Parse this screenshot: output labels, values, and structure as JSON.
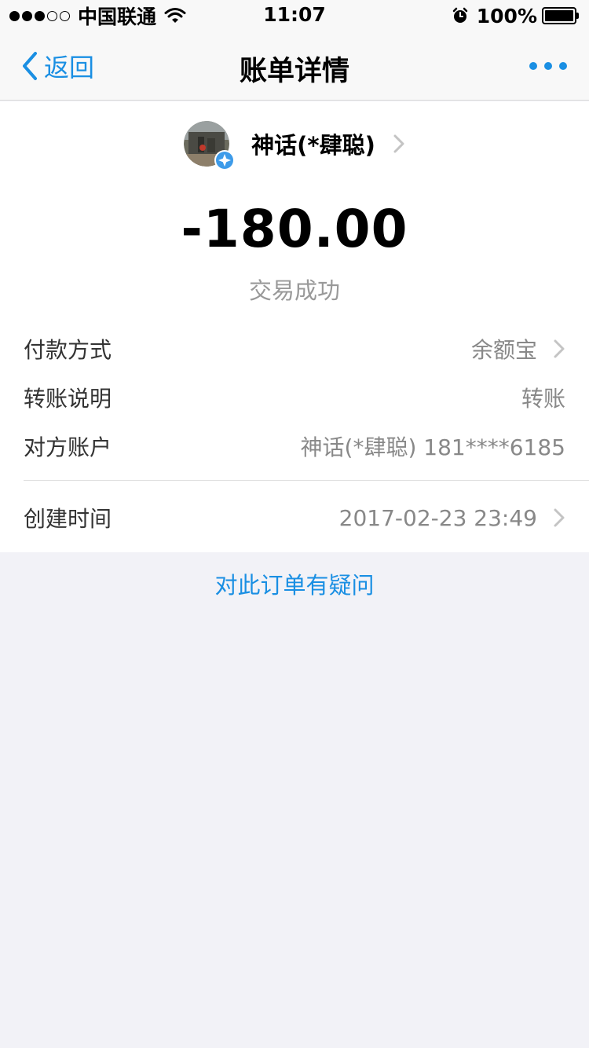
{
  "status_bar": {
    "carrier": "中国联通",
    "time": "11:07",
    "battery_percent": "100%",
    "signal_bars_filled": 3,
    "signal_bars_total": 5
  },
  "nav": {
    "back_label": "返回",
    "title": "账单详情",
    "more_icon": "more-icon"
  },
  "payee": {
    "name": "神话(*肆聪)"
  },
  "transaction": {
    "amount": "-180.00",
    "status": "交易成功"
  },
  "details": {
    "payment_method": {
      "label": "付款方式",
      "value": "余额宝"
    },
    "transfer_note": {
      "label": "转账说明",
      "value": "转账"
    },
    "counterparty": {
      "label": "对方账户",
      "value": "神话(*肆聪) 181****6185"
    },
    "created_time": {
      "label": "创建时间",
      "value": "2017-02-23 23:49"
    }
  },
  "question_link": "对此订单有疑问",
  "colors": {
    "accent": "#1a8fe3",
    "background": "#f2f2f7",
    "secondary_text": "#888888",
    "status_text": "#999999"
  }
}
